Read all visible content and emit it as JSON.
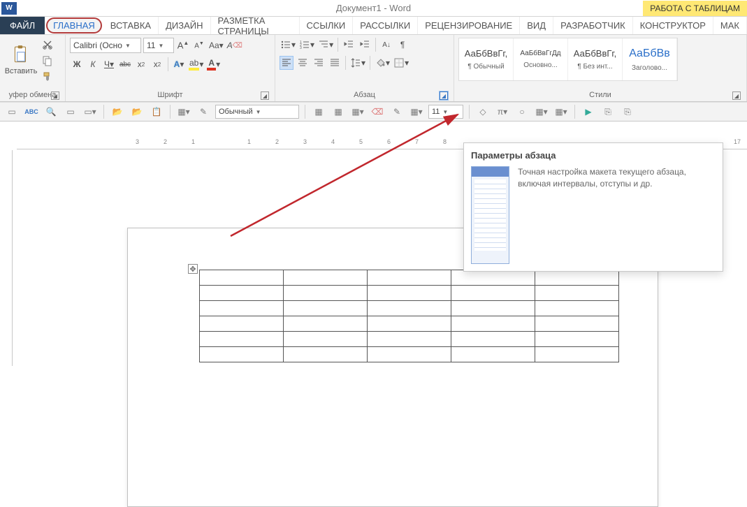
{
  "title": "Документ1 - Word",
  "contextual_tab": "РАБОТА С ТАБЛИЦАМ",
  "tabs": {
    "file": "ФАЙЛ",
    "items": [
      "ГЛАВНАЯ",
      "ВСТАВКА",
      "ДИЗАЙН",
      "РАЗМЕТКА СТРАНИЦЫ",
      "ССЫЛКИ",
      "РАССЫЛКИ",
      "РЕЦЕНЗИРОВАНИЕ",
      "ВИД",
      "РАЗРАБОТЧИК",
      "КОНСТРУКТОР",
      "МАК"
    ]
  },
  "ribbon": {
    "clipboard": {
      "label": "уфер обмена",
      "paste": "Вставить"
    },
    "font": {
      "label": "Шрифт",
      "font_name": "Calibri (Осно",
      "font_size": "11",
      "bold": "Ж",
      "italic": "К",
      "underline": "Ч",
      "strike": "abc",
      "sub": "x₂",
      "sup": "x²"
    },
    "paragraph": {
      "label": "Абзац"
    },
    "styles": {
      "label": "Стили",
      "items": [
        {
          "preview": "АаБбВвГг,",
          "name": "¶ Обычный",
          "color": "#333"
        },
        {
          "preview": "АаБбВвГгДд",
          "name": "Основно...",
          "color": "#333",
          "small": true
        },
        {
          "preview": "АаБбВвГг,",
          "name": "¶ Без инт...",
          "color": "#333"
        },
        {
          "preview": "АаБбВв",
          "name": "Заголово...",
          "color": "#2a6fc9",
          "big": true
        }
      ]
    }
  },
  "quickbar": {
    "style_combo": "Обычный",
    "size_combo": "11"
  },
  "ruler_marks": [
    "3",
    "2",
    "1",
    "1",
    "2",
    "3",
    "4",
    "5",
    "6",
    "7",
    "8",
    "17"
  ],
  "tooltip": {
    "title": "Параметры абзаца",
    "body": "Точная настройка макета текущего абзаца, включая интервалы, отступы и др."
  }
}
